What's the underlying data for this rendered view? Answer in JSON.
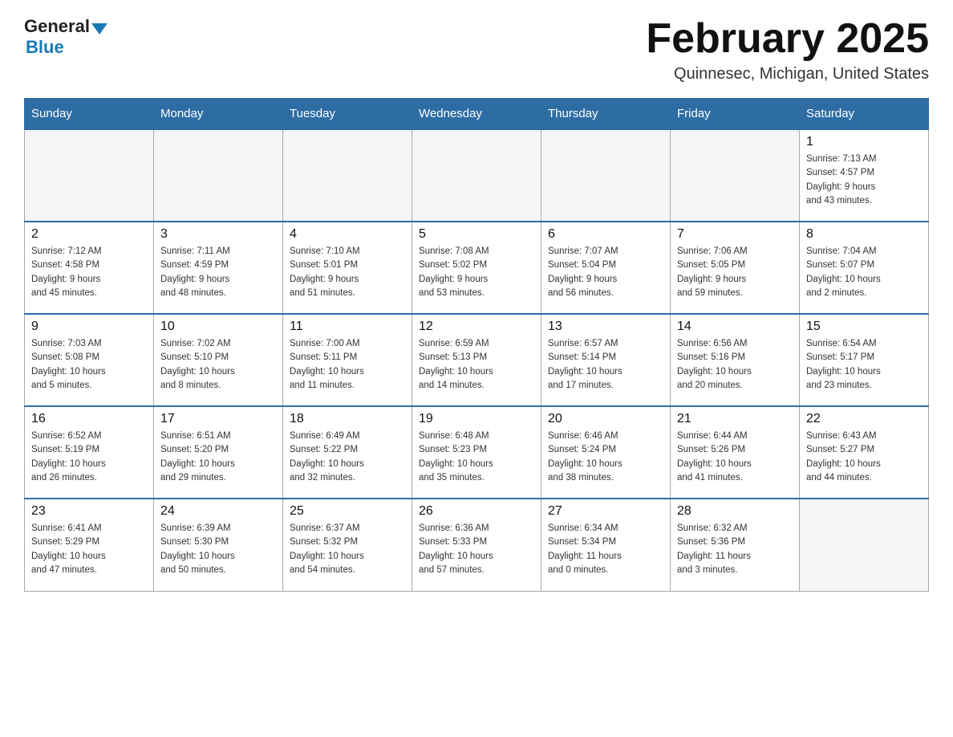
{
  "header": {
    "logo_general": "General",
    "logo_blue": "Blue",
    "month_title": "February 2025",
    "location": "Quinnesec, Michigan, United States"
  },
  "days_of_week": [
    "Sunday",
    "Monday",
    "Tuesday",
    "Wednesday",
    "Thursday",
    "Friday",
    "Saturday"
  ],
  "weeks": [
    [
      {
        "day": "",
        "info": "",
        "empty": true
      },
      {
        "day": "",
        "info": "",
        "empty": true
      },
      {
        "day": "",
        "info": "",
        "empty": true
      },
      {
        "day": "",
        "info": "",
        "empty": true
      },
      {
        "day": "",
        "info": "",
        "empty": true
      },
      {
        "day": "",
        "info": "",
        "empty": true
      },
      {
        "day": "1",
        "info": "Sunrise: 7:13 AM\nSunset: 4:57 PM\nDaylight: 9 hours\nand 43 minutes."
      }
    ],
    [
      {
        "day": "2",
        "info": "Sunrise: 7:12 AM\nSunset: 4:58 PM\nDaylight: 9 hours\nand 45 minutes."
      },
      {
        "day": "3",
        "info": "Sunrise: 7:11 AM\nSunset: 4:59 PM\nDaylight: 9 hours\nand 48 minutes."
      },
      {
        "day": "4",
        "info": "Sunrise: 7:10 AM\nSunset: 5:01 PM\nDaylight: 9 hours\nand 51 minutes."
      },
      {
        "day": "5",
        "info": "Sunrise: 7:08 AM\nSunset: 5:02 PM\nDaylight: 9 hours\nand 53 minutes."
      },
      {
        "day": "6",
        "info": "Sunrise: 7:07 AM\nSunset: 5:04 PM\nDaylight: 9 hours\nand 56 minutes."
      },
      {
        "day": "7",
        "info": "Sunrise: 7:06 AM\nSunset: 5:05 PM\nDaylight: 9 hours\nand 59 minutes."
      },
      {
        "day": "8",
        "info": "Sunrise: 7:04 AM\nSunset: 5:07 PM\nDaylight: 10 hours\nand 2 minutes."
      }
    ],
    [
      {
        "day": "9",
        "info": "Sunrise: 7:03 AM\nSunset: 5:08 PM\nDaylight: 10 hours\nand 5 minutes."
      },
      {
        "day": "10",
        "info": "Sunrise: 7:02 AM\nSunset: 5:10 PM\nDaylight: 10 hours\nand 8 minutes."
      },
      {
        "day": "11",
        "info": "Sunrise: 7:00 AM\nSunset: 5:11 PM\nDaylight: 10 hours\nand 11 minutes."
      },
      {
        "day": "12",
        "info": "Sunrise: 6:59 AM\nSunset: 5:13 PM\nDaylight: 10 hours\nand 14 minutes."
      },
      {
        "day": "13",
        "info": "Sunrise: 6:57 AM\nSunset: 5:14 PM\nDaylight: 10 hours\nand 17 minutes."
      },
      {
        "day": "14",
        "info": "Sunrise: 6:56 AM\nSunset: 5:16 PM\nDaylight: 10 hours\nand 20 minutes."
      },
      {
        "day": "15",
        "info": "Sunrise: 6:54 AM\nSunset: 5:17 PM\nDaylight: 10 hours\nand 23 minutes."
      }
    ],
    [
      {
        "day": "16",
        "info": "Sunrise: 6:52 AM\nSunset: 5:19 PM\nDaylight: 10 hours\nand 26 minutes."
      },
      {
        "day": "17",
        "info": "Sunrise: 6:51 AM\nSunset: 5:20 PM\nDaylight: 10 hours\nand 29 minutes."
      },
      {
        "day": "18",
        "info": "Sunrise: 6:49 AM\nSunset: 5:22 PM\nDaylight: 10 hours\nand 32 minutes."
      },
      {
        "day": "19",
        "info": "Sunrise: 6:48 AM\nSunset: 5:23 PM\nDaylight: 10 hours\nand 35 minutes."
      },
      {
        "day": "20",
        "info": "Sunrise: 6:46 AM\nSunset: 5:24 PM\nDaylight: 10 hours\nand 38 minutes."
      },
      {
        "day": "21",
        "info": "Sunrise: 6:44 AM\nSunset: 5:26 PM\nDaylight: 10 hours\nand 41 minutes."
      },
      {
        "day": "22",
        "info": "Sunrise: 6:43 AM\nSunset: 5:27 PM\nDaylight: 10 hours\nand 44 minutes."
      }
    ],
    [
      {
        "day": "23",
        "info": "Sunrise: 6:41 AM\nSunset: 5:29 PM\nDaylight: 10 hours\nand 47 minutes."
      },
      {
        "day": "24",
        "info": "Sunrise: 6:39 AM\nSunset: 5:30 PM\nDaylight: 10 hours\nand 50 minutes."
      },
      {
        "day": "25",
        "info": "Sunrise: 6:37 AM\nSunset: 5:32 PM\nDaylight: 10 hours\nand 54 minutes."
      },
      {
        "day": "26",
        "info": "Sunrise: 6:36 AM\nSunset: 5:33 PM\nDaylight: 10 hours\nand 57 minutes."
      },
      {
        "day": "27",
        "info": "Sunrise: 6:34 AM\nSunset: 5:34 PM\nDaylight: 11 hours\nand 0 minutes."
      },
      {
        "day": "28",
        "info": "Sunrise: 6:32 AM\nSunset: 5:36 PM\nDaylight: 11 hours\nand 3 minutes."
      },
      {
        "day": "",
        "info": "",
        "empty": true
      }
    ]
  ]
}
